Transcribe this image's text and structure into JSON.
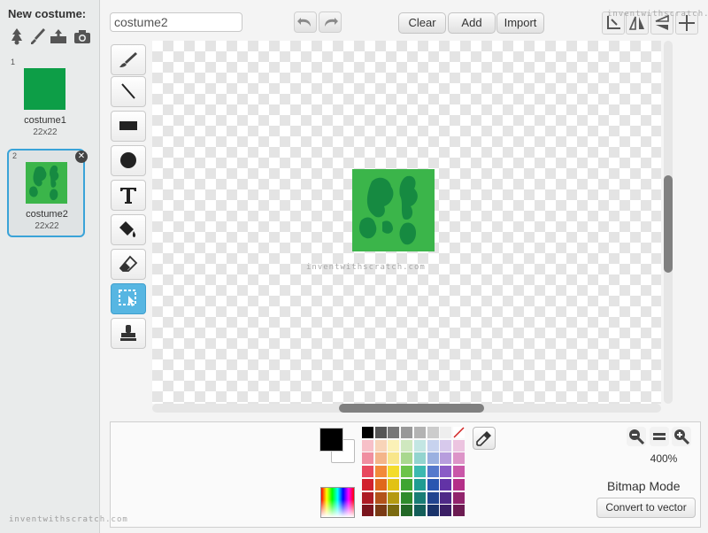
{
  "sidebar": {
    "new_costume_label": "New costume:",
    "new_costume_icons": [
      "sprite-library-icon",
      "paint-brush-icon",
      "upload-icon",
      "camera-icon"
    ],
    "costumes": [
      {
        "number": "1",
        "name": "costume1",
        "size": "22x22",
        "selected": false
      },
      {
        "number": "2",
        "name": "costume2",
        "size": "22x22",
        "selected": true
      }
    ]
  },
  "toolbar": {
    "costume_name": "costume2",
    "clear_label": "Clear",
    "add_label": "Add",
    "import_label": "Import",
    "undo_icon": "undo-icon",
    "redo_icon": "redo-icon",
    "right_icons": [
      "rotation-center-icon",
      "flip-horizontal-icon",
      "flip-vertical-icon",
      "set-costume-center-icon"
    ]
  },
  "tools": [
    "brush-icon",
    "line-icon",
    "rectangle-icon",
    "ellipse-icon",
    "text-icon",
    "fill-icon",
    "eraser-icon",
    "select-icon",
    "stamp-icon"
  ],
  "active_tool": "select-icon",
  "watermark": "inventwithscratch.com",
  "palette": {
    "primary_color": "#000000",
    "secondary_color": "#ffffff",
    "rows": [
      [
        "#000000",
        "#555555",
        "#777777",
        "#999999",
        "#b3b3b3",
        "#cccccc",
        "#eeeeee",
        "#ffffff"
      ],
      [
        "#f7c0c8",
        "#f8d4b8",
        "#fbf1b7",
        "#cfe8bf",
        "#c3e6e3",
        "#c7d2ee",
        "#d7c9ec",
        "#ecc4e0"
      ],
      [
        "#f08ea0",
        "#f4b58a",
        "#f8e68a",
        "#a9d88f",
        "#93d4cf",
        "#9ab0e0",
        "#b79ddd",
        "#dd94c8"
      ],
      [
        "#e8485e",
        "#f28a3a",
        "#f3dc2c",
        "#6cc34a",
        "#3cb9b0",
        "#5579cc",
        "#8a5cc6",
        "#c957a8"
      ],
      [
        "#d1212e",
        "#e0681c",
        "#e2c213",
        "#3fa532",
        "#1f9c92",
        "#2a56b0",
        "#6233a6",
        "#b42f88"
      ],
      [
        "#ad1c25",
        "#b3521a",
        "#b59a12",
        "#2f8b2c",
        "#197d75",
        "#22448f",
        "#4f2a87",
        "#92246d"
      ],
      [
        "#7a151d",
        "#7a3a14",
        "#7b6a10",
        "#236826",
        "#135e59",
        "#1a336a",
        "#3b1f66",
        "#6c1b52"
      ]
    ],
    "transparent_swatch": "no-color-icon"
  },
  "zoom": {
    "zoom_out_icon": "zoom-out-icon",
    "reset_icon": "zoom-reset-icon",
    "zoom_in_icon": "zoom-in-icon",
    "level": "400%"
  },
  "mode": {
    "label": "Bitmap Mode",
    "convert_label": "Convert to vector"
  }
}
